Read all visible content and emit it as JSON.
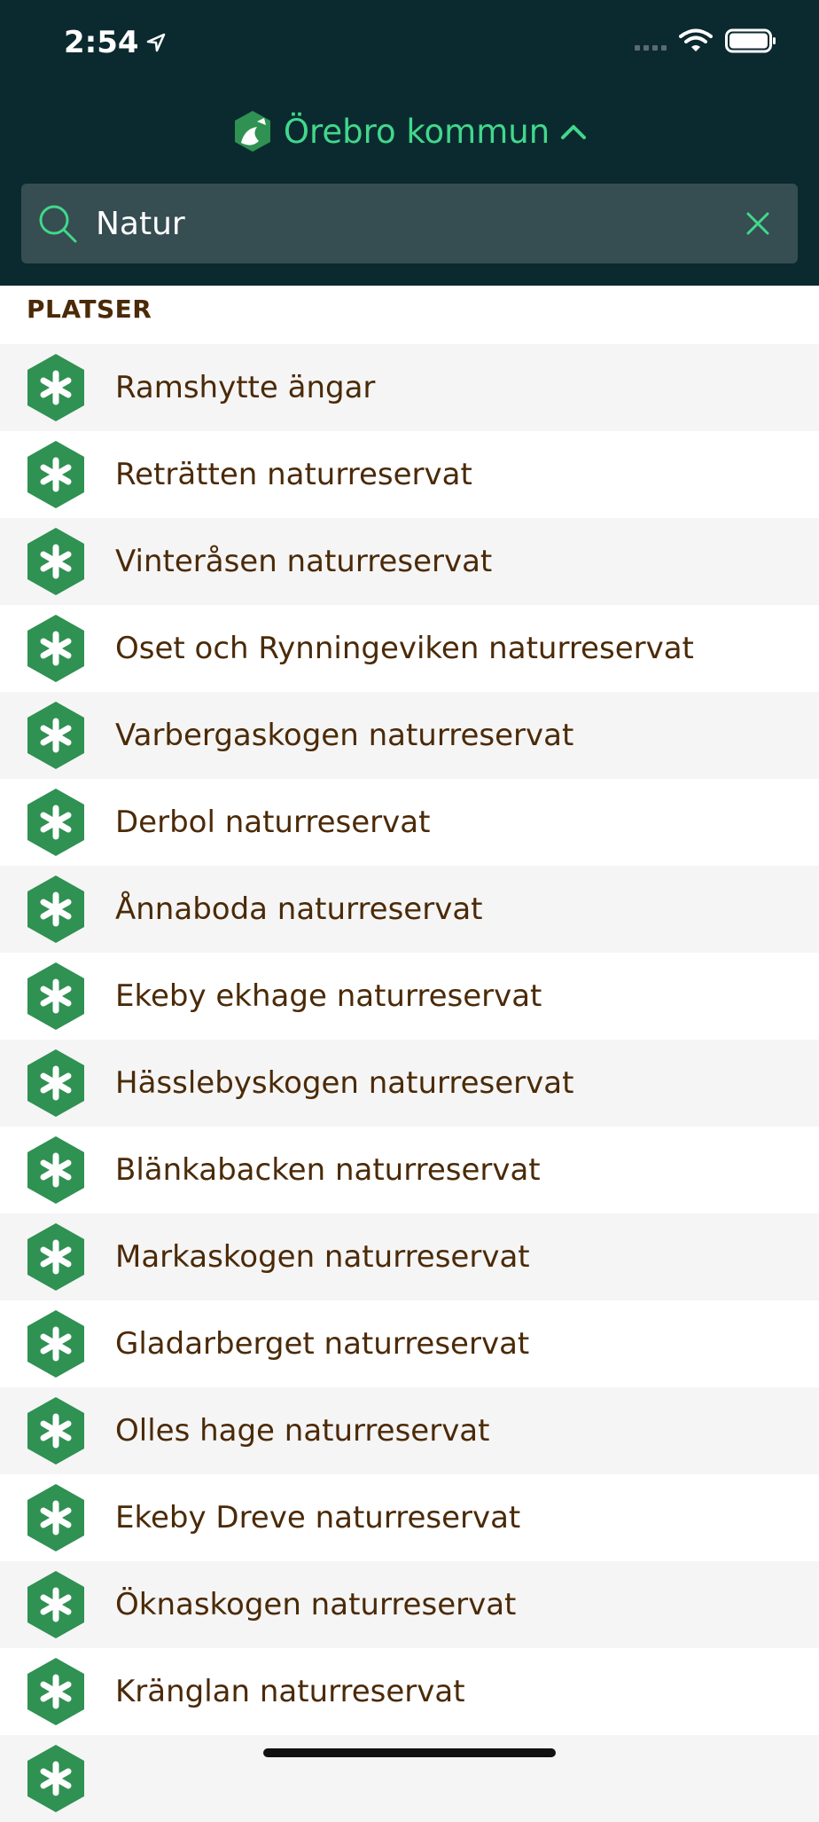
{
  "status_bar": {
    "time": "2:54"
  },
  "header": {
    "municipality": "Örebro kommun"
  },
  "search": {
    "value": "Natur",
    "placeholder": ""
  },
  "section": {
    "label": "PLATSER"
  },
  "places": [
    "Ramshytte ängar",
    "Reträtten naturreservat",
    "Vinteråsen naturreservat",
    "Oset och Rynningeviken naturreservat",
    "Varbergaskogen naturreservat",
    "Derbol naturreservat",
    "Ånnaboda naturreservat",
    "Ekeby ekhage naturreservat",
    "Hässlebyskogen naturreservat",
    "Blänkabacken naturreservat",
    "Markaskogen naturreservat",
    "Gladarberget naturreservat",
    "Olles hage naturreservat",
    "Ekeby Dreve naturreservat",
    "Öknaskogen naturreservat",
    "Kränglan naturreservat",
    ""
  ],
  "colors": {
    "header_bg": "#0b2a30",
    "accent": "#41d88b",
    "icon_green": "#2f9152",
    "text_brown": "#4b2a08"
  },
  "icons": {
    "place_icon": "nature-hexagon-icon",
    "search": "search-icon",
    "clear": "close-icon"
  }
}
